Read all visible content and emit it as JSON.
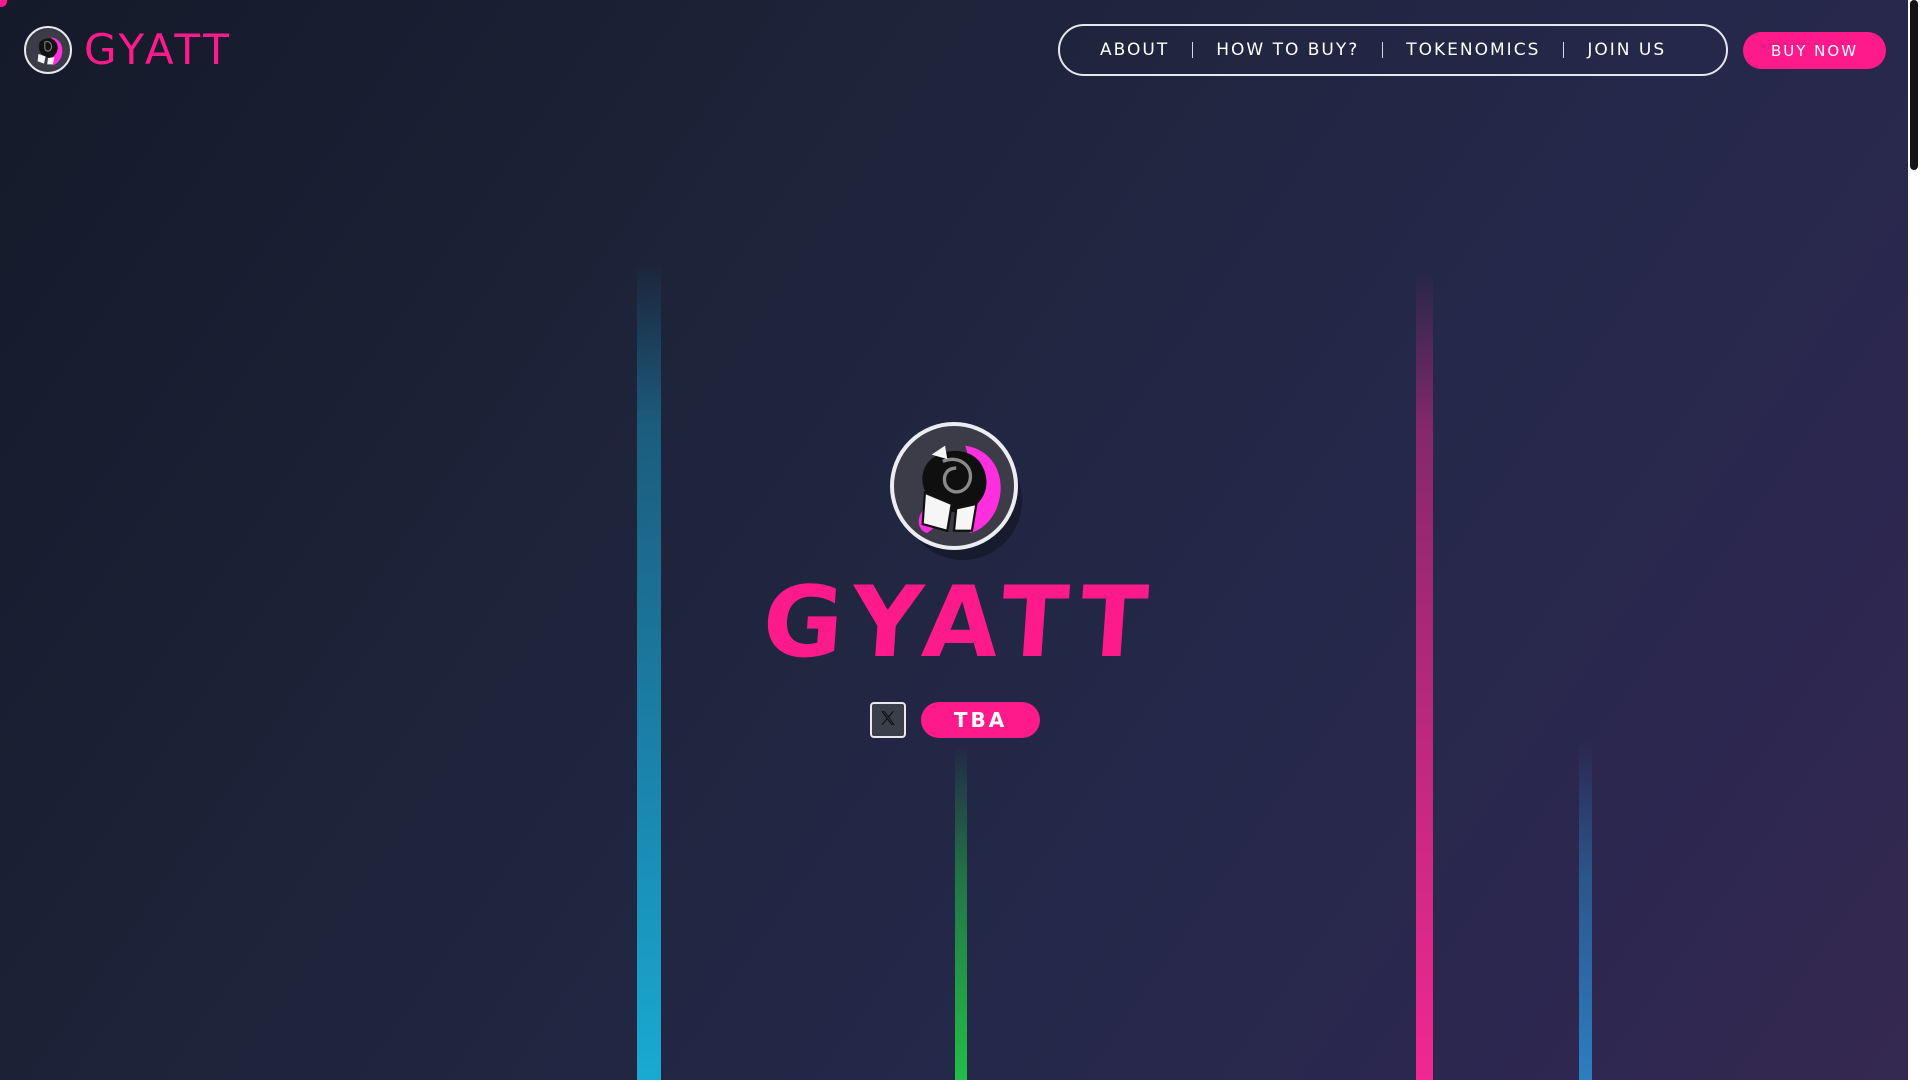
{
  "header": {
    "brand_name": "GYATT",
    "logo_icon": "gyatt-mascot-icon"
  },
  "nav": {
    "items": [
      {
        "label": "ABOUT"
      },
      {
        "label": "HOW TO BUY?"
      },
      {
        "label": "TOKENOMICS"
      },
      {
        "label": "JOIN US"
      }
    ],
    "buy_now_label": "BUY NOW"
  },
  "hero": {
    "title": "GYATT",
    "logo_icon": "gyatt-mascot-icon",
    "social_icon": "x-icon",
    "tba_label": "TBA"
  },
  "colors": {
    "accent": "#ff1a8c",
    "background_start": "#141a29",
    "background_end": "#352950",
    "beam_cyan": "#19a0cd",
    "beam_green": "#22b446",
    "beam_magenta": "#e6288c",
    "beam_blue": "#2d82c8"
  }
}
